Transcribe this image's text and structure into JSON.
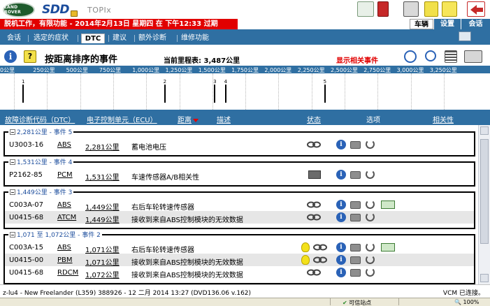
{
  "header": {
    "logo_text": "LAND ROVER",
    "app_logo": "SDD",
    "product": "TOPIx"
  },
  "alert_bar": {
    "text": "脱机工作，有限功能 - 2014年2月13日 星期四 在 下午12:33 过期"
  },
  "top_nav": {
    "vehicle": "车辆",
    "settings": "设置",
    "session": "会话"
  },
  "main_tabs": [
    {
      "label": "会话"
    },
    {
      "label": "选定的症状"
    },
    {
      "label": "DTC",
      "active": true
    },
    {
      "label": "建议"
    },
    {
      "label": "额外诊断"
    },
    {
      "label": "维修功能"
    }
  ],
  "toolbar": {
    "title": "按距离排序的事件",
    "odometer": "当前里程表: 3,487公里",
    "related_link": "显示相关事件"
  },
  "timeline": {
    "ticks": [
      "0公里",
      "250公里",
      "500公里",
      "750公里",
      "1,000公里",
      "1,250公里",
      "1,500公里",
      "1,750公里",
      "2,000公里",
      "2,250公里",
      "2,500公里",
      "2,750公里",
      "3,000公里",
      "3,250公里"
    ],
    "max_km": 3487,
    "events": [
      {
        "num": "1",
        "km": 0
      },
      {
        "num": "2",
        "km": 1071
      },
      {
        "num": "3",
        "km": 1449
      },
      {
        "num": "4",
        "km": 1531
      },
      {
        "num": "5",
        "km": 2281
      }
    ]
  },
  "columns": {
    "dtc": "故障诊断代码（DTC）",
    "ecu": "电子控制单元（ECU）",
    "distance": "距离",
    "description": "描述",
    "status": "状态",
    "options": "选项",
    "relevance": "相关性"
  },
  "groups": [
    {
      "title": "2,281公里 - 事件 5",
      "rows": [
        {
          "dtc": "U3003-16",
          "ecu": "ABS",
          "distance": "2,281公里",
          "desc": "蓄电池电压",
          "status": "chain",
          "green": false
        }
      ]
    },
    {
      "title": "1,531公里 - 事件 4",
      "rows": [
        {
          "dtc": "P2162-85",
          "ecu": "PCM",
          "distance": "1,531公里",
          "desc": "车速传感器A/B相关性",
          "status": "grid-chain",
          "green": false
        }
      ]
    },
    {
      "title": "1,449公里 - 事件 3",
      "rows": [
        {
          "dtc": "C003A-07",
          "ecu": "ABS",
          "distance": "1,449公里",
          "desc": "右后车轮转速传感器",
          "status": "chain",
          "green": true
        },
        {
          "dtc": "U0415-68",
          "ecu": "ATCM",
          "distance": "1,449公里",
          "desc": "接收到来自ABS控制模块的无效数据",
          "status": "chain",
          "green": false
        }
      ]
    },
    {
      "title": "1,071 至 1,072公里 - 事件 2",
      "rows": [
        {
          "dtc": "C003A-15",
          "ecu": "ABS",
          "distance": "1,071公里",
          "desc": "右后车轮转速传感器",
          "status": "bulb-chain",
          "green": true
        },
        {
          "dtc": "U0415-00",
          "ecu": "PBM",
          "distance": "1,071公里",
          "desc": "接收到来自ABS控制模块的无效数据",
          "status": "bulb-chain",
          "green": false
        },
        {
          "dtc": "U0415-68",
          "ecu": "RDCM",
          "distance": "1,072公里",
          "desc": "接收到来自ABS控制模块的无效数据",
          "status": "chain",
          "green": false
        }
      ]
    }
  ],
  "status_bar": {
    "left": "z-lu4 - New Freelander (L359) 388926 - 12 二月 2014 13:27 (DVD136.06 v.162)",
    "right": "VCM 已连接。"
  },
  "browser_status": {
    "zone": "可信站点",
    "zoom": "100%"
  },
  "colors": {
    "accent_blue": "#2f6fa2",
    "alert_red": "#e10000",
    "link_red": "#e10000"
  }
}
